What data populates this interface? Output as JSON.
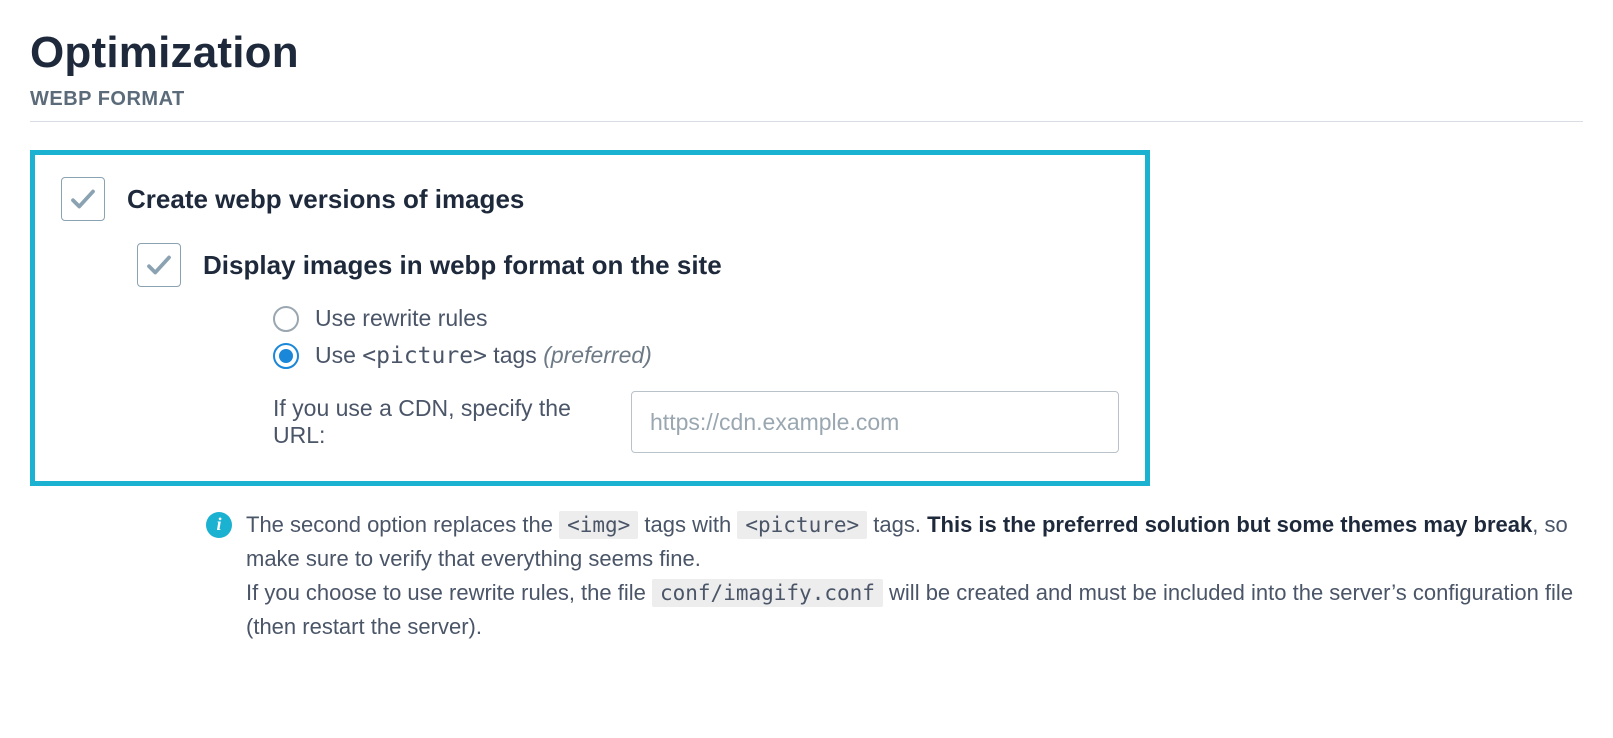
{
  "page": {
    "title": "Optimization",
    "section": "WEBP FORMAT"
  },
  "panel": {
    "create_webp": {
      "checked": true,
      "label": "Create webp versions of images"
    },
    "display_webp": {
      "checked": true,
      "label": "Display images in webp format on the site"
    },
    "radios": {
      "rewrite": {
        "selected": false,
        "label": "Use rewrite rules"
      },
      "picture": {
        "selected": true,
        "label_pre": "Use ",
        "label_code": "<picture>",
        "label_post": " tags ",
        "preferred": "(preferred)"
      }
    },
    "cdn": {
      "label": "If you use a CDN, specify the URL:",
      "placeholder": "https://cdn.example.com",
      "value": ""
    }
  },
  "note": {
    "line1_a": "The second option replaces the ",
    "line1_code1": "<img>",
    "line1_b": " tags with ",
    "line1_code2": "<picture>",
    "line1_c": " tags. ",
    "line1_bold": "This is the preferred solution but some themes may break",
    "line1_d": ", so make sure to verify that everything seems fine.",
    "line2_a": "If you choose to use rewrite rules, the file ",
    "line2_code": "conf/imagify.conf",
    "line2_b": " will be created and must be included into the server’s configuration file (then restart the server)."
  }
}
